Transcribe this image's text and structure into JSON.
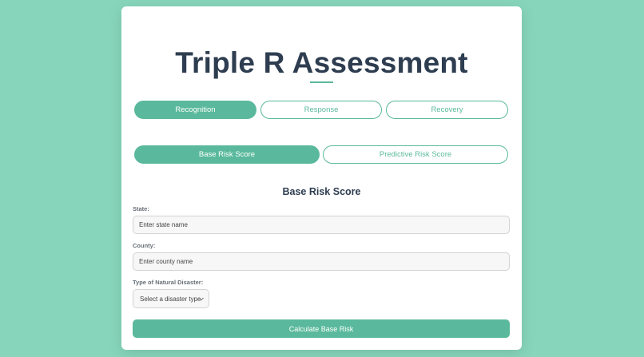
{
  "header": {
    "title": "Triple R Assessment"
  },
  "tabs": [
    {
      "label": "Recognition",
      "active": true
    },
    {
      "label": "Response",
      "active": false
    },
    {
      "label": "Recovery",
      "active": false
    }
  ],
  "subtabs": [
    {
      "label": "Base Risk Score",
      "active": true
    },
    {
      "label": "Predictive Risk Score",
      "active": false
    }
  ],
  "form": {
    "section_title": "Base Risk Score",
    "state_label": "State:",
    "state_placeholder": "Enter state name",
    "county_label": "County:",
    "county_placeholder": "Enter county name",
    "disaster_label": "Type of Natural Disaster:",
    "disaster_selected": "Select a disaster type",
    "submit_label": "Calculate Base Risk"
  },
  "colors": {
    "background": "#87d6bc",
    "accent": "#5ab99c",
    "title": "#2e3d50"
  }
}
